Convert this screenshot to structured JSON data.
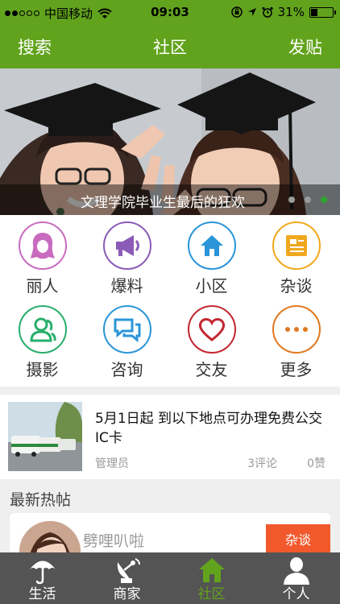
{
  "status_bar": {
    "carrier": "中国移动",
    "time": "09:03",
    "battery": "31%",
    "battery_level": 0.31,
    "signal_bars_filled": 2,
    "signal_bars_total": 5
  },
  "nav": {
    "left": "搜索",
    "title": "社区",
    "right": "发贴"
  },
  "banner": {
    "caption": "文理学院毕业生最后的狂欢",
    "slide_count": 3,
    "active_slide": 3
  },
  "categories": [
    {
      "label": "丽人",
      "icon": "woman-icon",
      "color": "#c96bbf"
    },
    {
      "label": "爆料",
      "icon": "megaphone-icon",
      "color": "#8c5bb8"
    },
    {
      "label": "小区",
      "icon": "house-icon",
      "color": "#2a95d8"
    },
    {
      "label": "杂谈",
      "icon": "document-icon",
      "color": "#f0a81e"
    },
    {
      "label": "摄影",
      "icon": "people-icon",
      "color": "#27ae6b"
    },
    {
      "label": "咨询",
      "icon": "chat-icon",
      "color": "#2a95d8"
    },
    {
      "label": "交友",
      "icon": "heart-icon",
      "color": "#c32630"
    },
    {
      "label": "更多",
      "icon": "more-icon",
      "color": "#e07820"
    }
  ],
  "news": {
    "title": "5月1日起 到以下地点可办理免费公交IC卡",
    "author": "管理员",
    "comments": "3评论",
    "likes": "0赞"
  },
  "section": {
    "title": "最新热帖"
  },
  "post": {
    "author": "劈哩叭啦",
    "tag": "杂谈"
  },
  "tabs": [
    {
      "label": "生活",
      "icon": "umbrella-icon"
    },
    {
      "label": "商家",
      "icon": "satellite-dish-icon"
    },
    {
      "label": "社区",
      "icon": "home-icon",
      "active": true
    },
    {
      "label": "个人",
      "icon": "person-icon"
    }
  ],
  "colors": {
    "brand": "#62a31d",
    "tab_bar": "#545454",
    "tag": "#f1592d"
  }
}
